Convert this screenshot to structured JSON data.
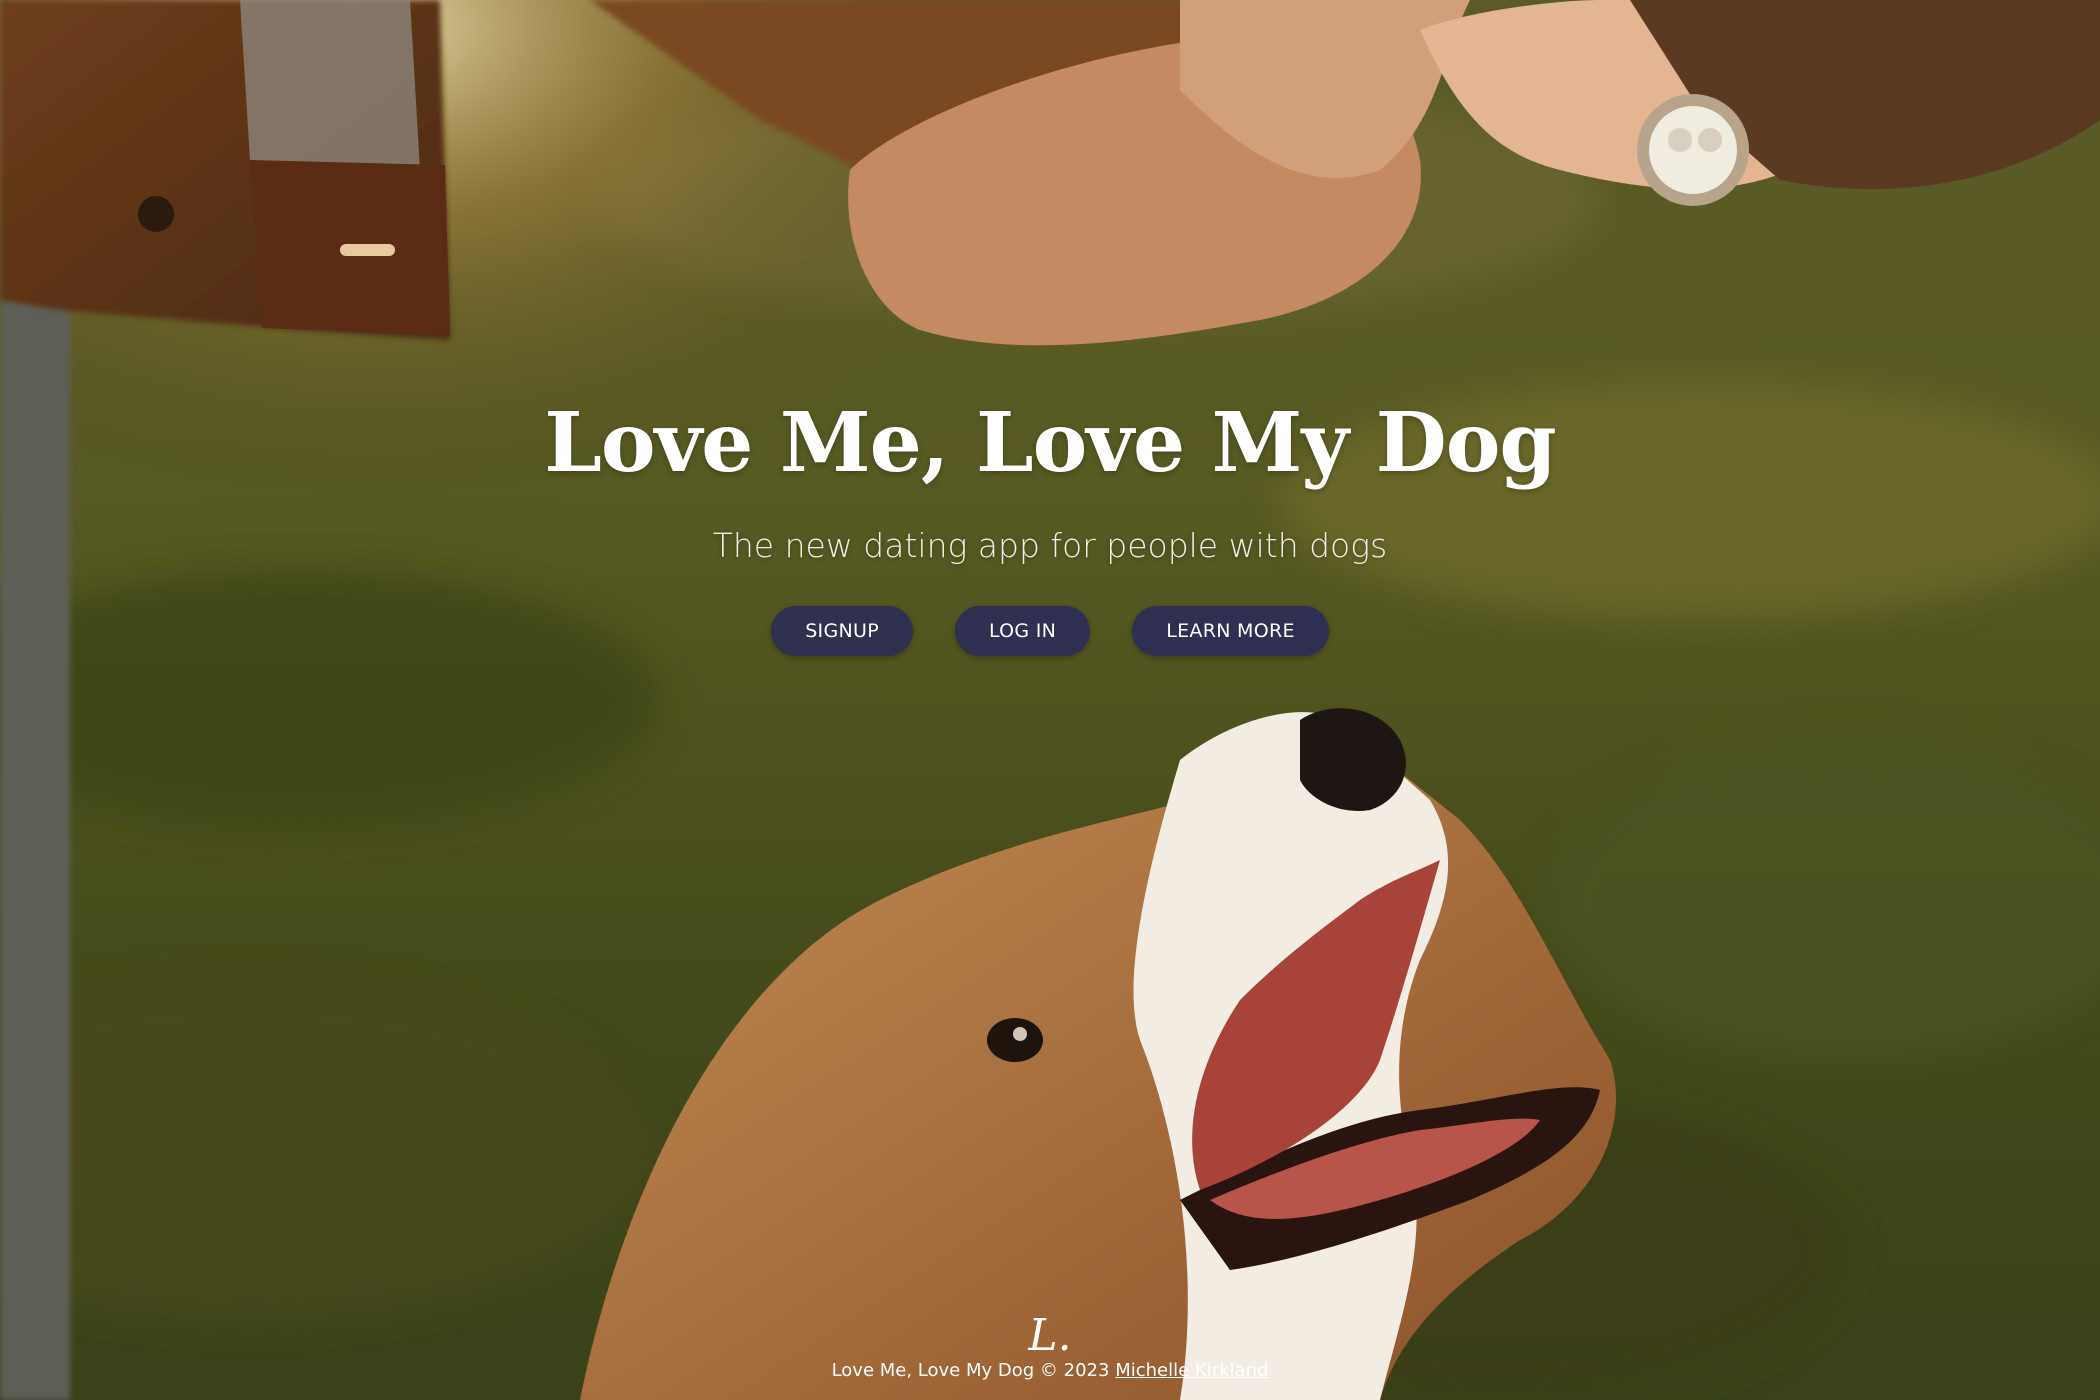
{
  "hero": {
    "title": "Love Me, Love My Dog",
    "subtitle": "The new dating app for people with dogs",
    "buttons": {
      "signup": "SIGNUP",
      "login": "LOG IN",
      "learn_more": "LEARN MORE"
    },
    "button_color": "#2f2f52"
  },
  "footer": {
    "logo_mark": "L.",
    "site_name": "Love Me, Love My Dog",
    "copyright": "©",
    "year": "2023",
    "author_link": "Michelle Kirkland"
  },
  "background": {
    "description_icon": "photo-background-icon",
    "palette": [
      "#4c4a1c",
      "#6b5a22",
      "#2d2a10"
    ]
  }
}
